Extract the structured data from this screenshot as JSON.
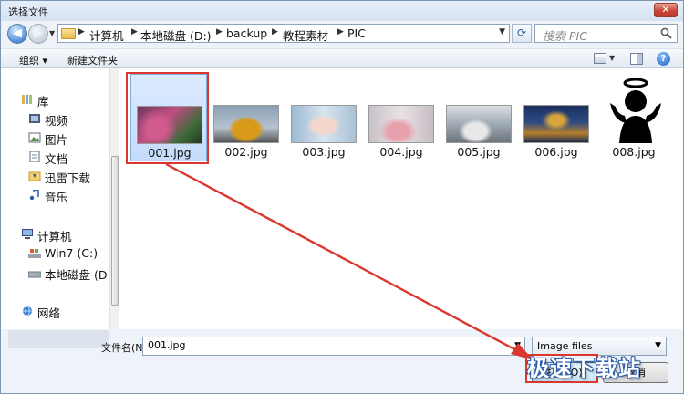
{
  "window": {
    "title": "选择文件"
  },
  "nav": {
    "breadcrumbs": [
      "计算机",
      "本地磁盘 (D:)",
      "backup",
      "教程素材",
      "PIC"
    ],
    "search_placeholder": "搜索 PIC"
  },
  "toolbar": {
    "organize": "组织 ▾",
    "new_folder": "新建文件夹"
  },
  "sidebar": {
    "libraries": "库",
    "library_items": [
      "视频",
      "图片",
      "文档",
      "迅雷下载",
      "音乐"
    ],
    "computer": "计算机",
    "drives": [
      "Win7 (C:)",
      "本地磁盘 (D:"
    ],
    "network": "网络"
  },
  "files": [
    {
      "name": "001.jpg",
      "selected": true
    },
    {
      "name": "002.jpg"
    },
    {
      "name": "003.jpg"
    },
    {
      "name": "004.jpg"
    },
    {
      "name": "005.jpg"
    },
    {
      "name": "006.jpg"
    },
    {
      "name": "008.jpg"
    }
  ],
  "bottom": {
    "filename_label": "文件名(N):",
    "filename_value": "001.jpg",
    "filetype_value": "Image files",
    "open_label": "打开(O)",
    "cancel_label": "取消"
  },
  "watermark": "极速下载站",
  "colors": {
    "annotation": "#d9382e",
    "selection": "#c4dcfa",
    "accent": "#2a5aa8"
  }
}
